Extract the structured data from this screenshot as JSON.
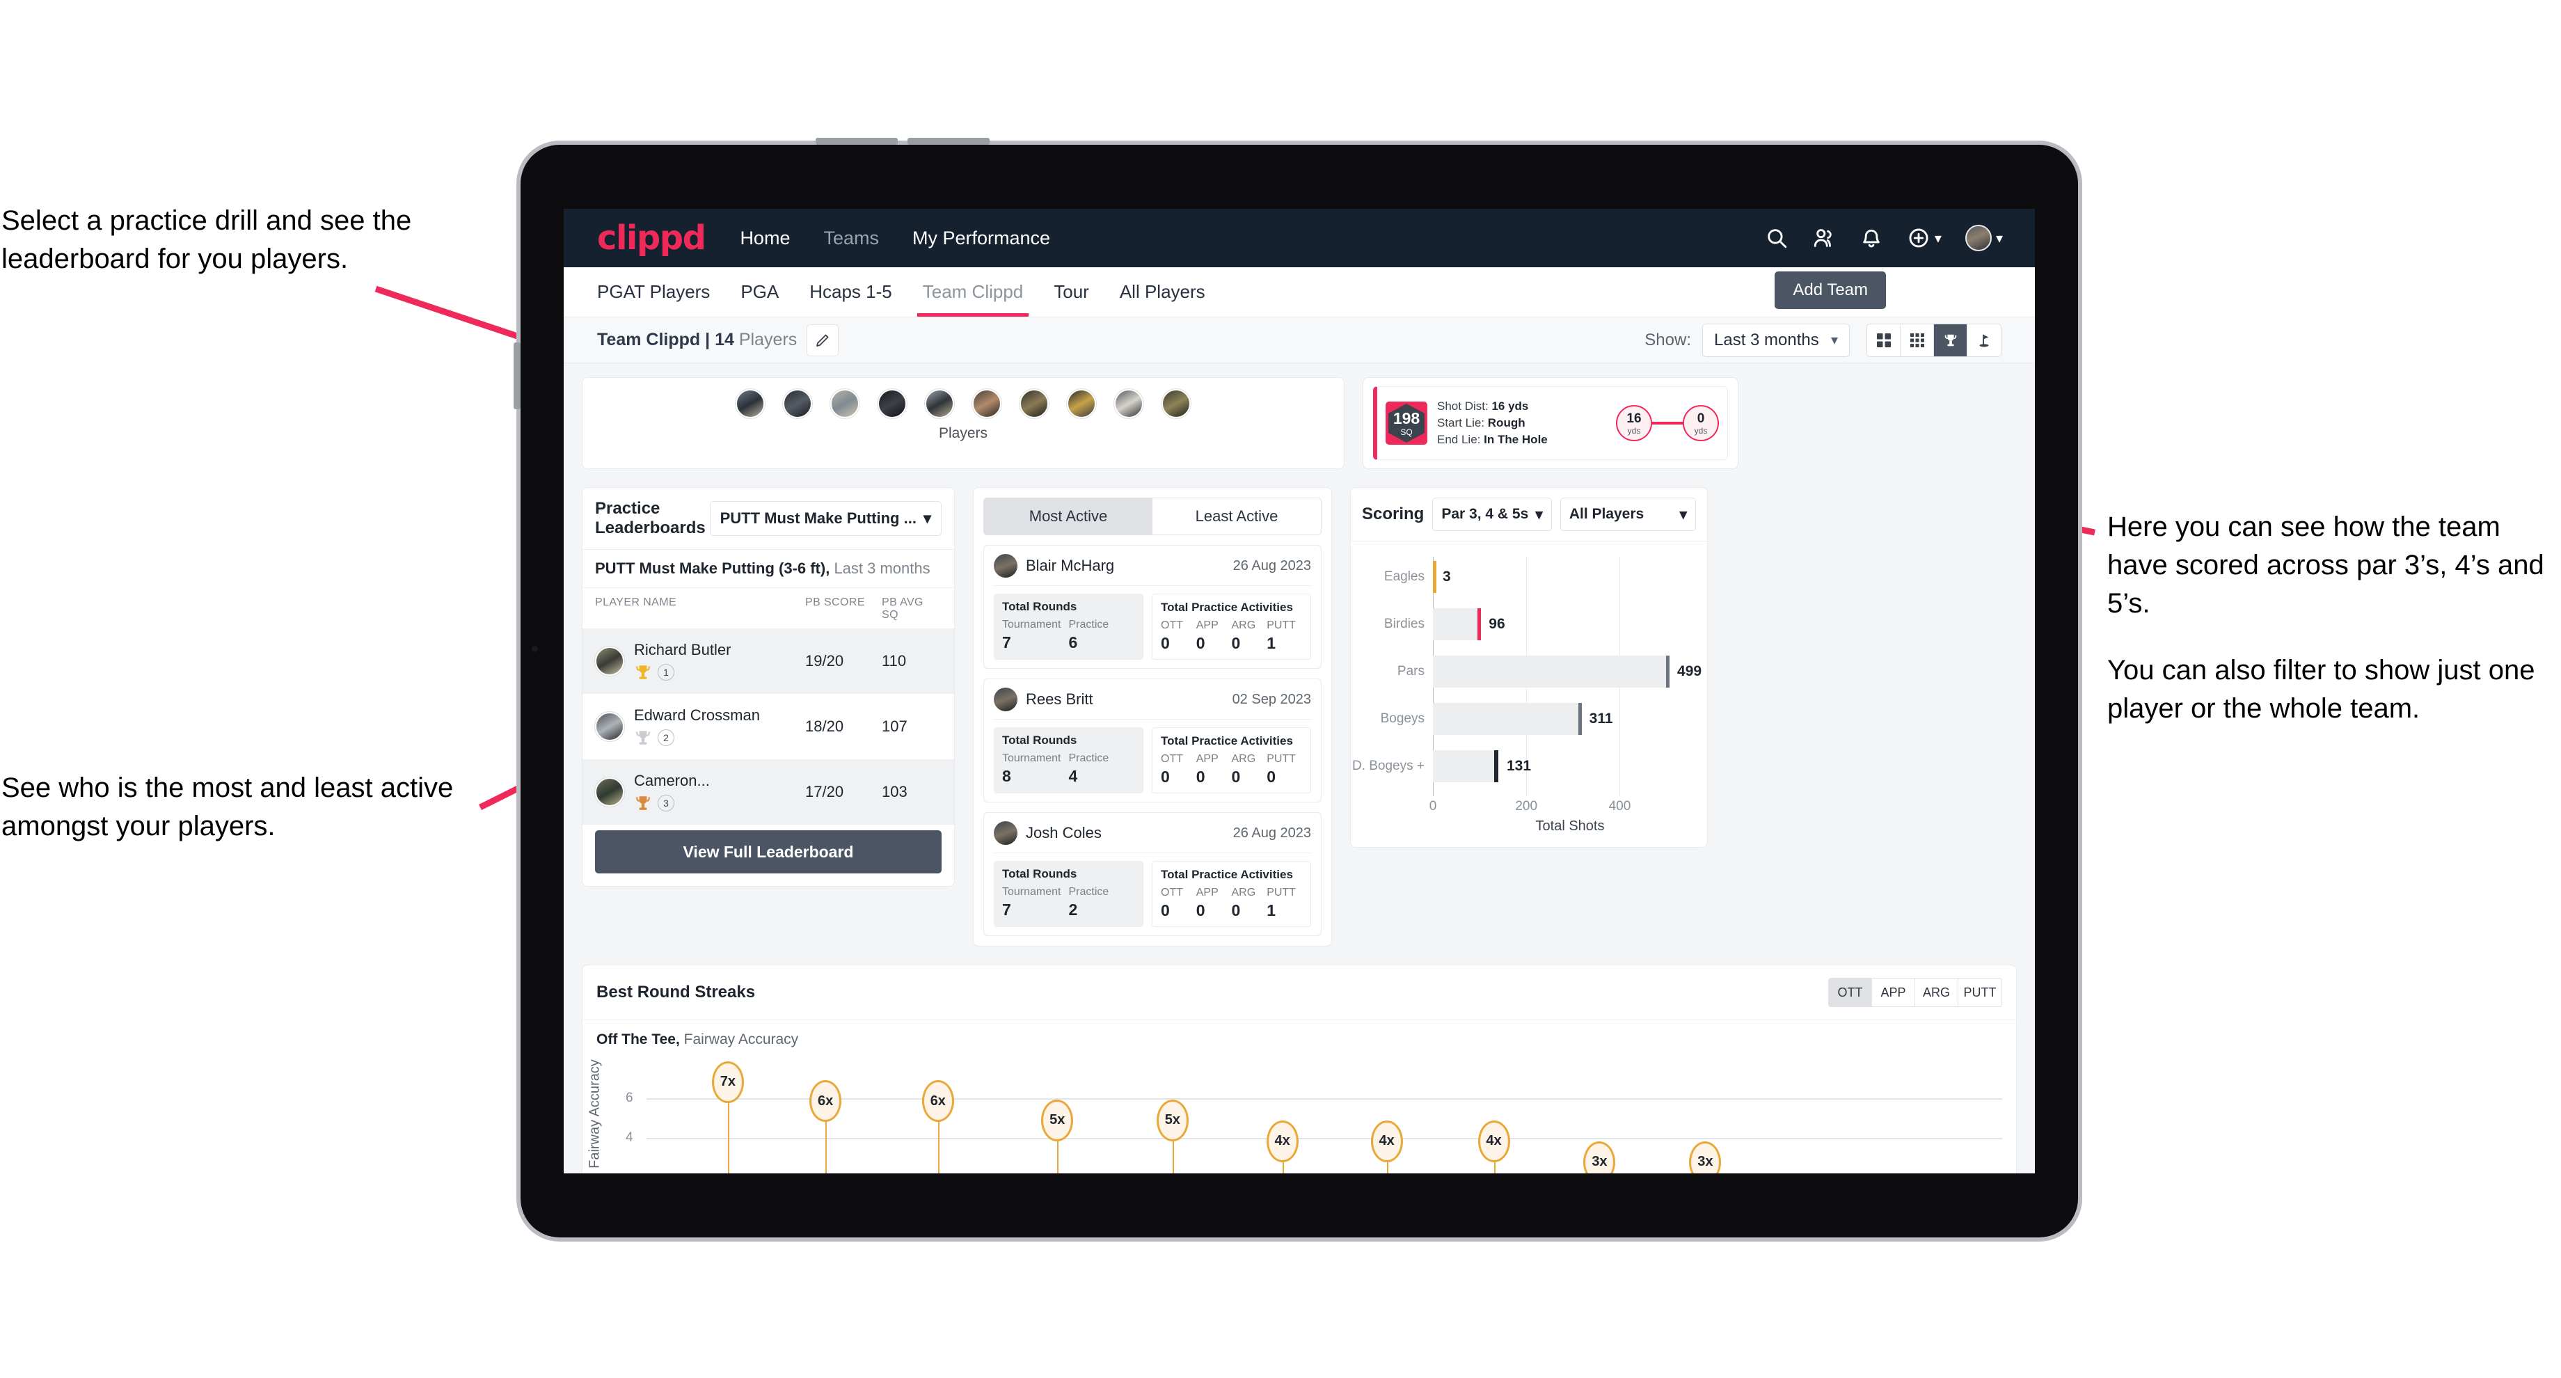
{
  "annotations": {
    "top_left": "Select a practice drill and see the leaderboard for you players.",
    "bottom_left": "See who is the most and least active amongst your players.",
    "right_1": "Here you can see how the team have scored across par 3’s, 4’s and 5’s.",
    "right_2": "You can also filter to show just one player or the whole team."
  },
  "navbar": {
    "logo": "clippd",
    "links": [
      {
        "label": "Home",
        "muted": false
      },
      {
        "label": "Teams",
        "muted": true
      },
      {
        "label": "My Performance",
        "muted": false
      }
    ],
    "icons": [
      "search-icon",
      "people-icon",
      "bell-icon",
      "plus-circle-icon",
      "avatar"
    ]
  },
  "tabs": [
    {
      "label": "PGAT Players",
      "active": false
    },
    {
      "label": "PGA",
      "active": false
    },
    {
      "label": "Hcaps 1-5",
      "active": false
    },
    {
      "label": "Team Clippd",
      "active": true
    },
    {
      "label": "Tour",
      "active": false
    },
    {
      "label": "All Players",
      "active": false
    }
  ],
  "add_team_button": "Add Team",
  "subbar": {
    "team_name": "Team Clippd",
    "separator": "|",
    "player_count": "14",
    "players_word": "Players",
    "edit_icon": "pencil-icon",
    "show_label": "Show:",
    "period_value": "Last 3 months",
    "view_buttons": [
      {
        "icon": "grid-4-icon",
        "selected": false
      },
      {
        "icon": "grid-9-icon",
        "selected": false
      },
      {
        "icon": "trophy-icon",
        "selected": true
      },
      {
        "icon": "golf-flag-icon",
        "selected": false
      }
    ]
  },
  "players_strip": {
    "caption": "Players",
    "count": 10
  },
  "shot_card": {
    "badge_number": "198",
    "badge_unit": "SQ",
    "lines": [
      {
        "label": "Shot Dist:",
        "value": "16 yds"
      },
      {
        "label": "Start Lie:",
        "value": "Rough"
      },
      {
        "label": "End Lie:",
        "value": "In The Hole"
      }
    ],
    "start_value": "16",
    "start_unit": "yds",
    "end_value": "0",
    "end_unit": "yds"
  },
  "leaderboard": {
    "title": "Practice Leaderboards",
    "drill_select": "PUTT Must Make Putting ...",
    "subtitle_bold": "PUTT Must Make Putting (3-6 ft),",
    "subtitle_grey": " Last 3 months",
    "columns": [
      "PLAYER NAME",
      "PB SCORE",
      "PB AVG SQ"
    ],
    "rows": [
      {
        "name": "Richard Butler",
        "rank": "1",
        "medal": "gold",
        "score": "19/20",
        "avg": "110"
      },
      {
        "name": "Edward Crossman",
        "rank": "2",
        "medal": "silver",
        "score": "18/20",
        "avg": "107"
      },
      {
        "name": "Cameron...",
        "rank": "3",
        "medal": "bronze",
        "score": "17/20",
        "avg": "103"
      }
    ],
    "button": "View Full Leaderboard"
  },
  "activity": {
    "tabs": [
      {
        "label": "Most Active",
        "active": true
      },
      {
        "label": "Least Active",
        "active": false
      }
    ],
    "rounds_title": "Total Rounds",
    "rounds_labels": [
      "Tournament",
      "Practice"
    ],
    "acts_title": "Total Practice Activities",
    "acts_labels": [
      "OTT",
      "APP",
      "ARG",
      "PUTT"
    ],
    "players": [
      {
        "name": "Blair McHarg",
        "date": "26 Aug 2023",
        "rounds": [
          "7",
          "6"
        ],
        "acts": [
          "0",
          "0",
          "0",
          "1"
        ]
      },
      {
        "name": "Rees Britt",
        "date": "02 Sep 2023",
        "rounds": [
          "8",
          "4"
        ],
        "acts": [
          "0",
          "0",
          "0",
          "0"
        ]
      },
      {
        "name": "Josh Coles",
        "date": "26 Aug 2023",
        "rounds": [
          "7",
          "2"
        ],
        "acts": [
          "0",
          "0",
          "0",
          "1"
        ]
      }
    ]
  },
  "scoring": {
    "title": "Scoring",
    "par_select": "Par 3, 4 & 5s",
    "players_select": "All Players"
  },
  "streaks": {
    "title": "Best Round Streaks",
    "tabs": [
      {
        "label": "OTT",
        "active": true
      },
      {
        "label": "APP",
        "active": false
      },
      {
        "label": "ARG",
        "active": false
      },
      {
        "label": "PUTT",
        "active": false
      }
    ],
    "subtitle_bold": "Off The Tee,",
    "subtitle_grey": " Fairway Accuracy"
  },
  "chart_data": [
    {
      "type": "bar",
      "orientation": "horizontal",
      "title": "Scoring",
      "categories": [
        "Eagles",
        "Birdies",
        "Pars",
        "Bogeys",
        "D. Bogeys +"
      ],
      "values": [
        3,
        96,
        499,
        311,
        131
      ],
      "bar_cap_colors": [
        "#e8a93a",
        "#ef2a5b",
        "#6b7280",
        "#6b7280",
        "#1e252e"
      ],
      "xlabel": "Total Shots",
      "ylabel": "",
      "xlim": [
        0,
        560
      ],
      "xticks": [
        0,
        200,
        400
      ],
      "grid": true,
      "legend": "none"
    },
    {
      "type": "scatter",
      "title": "Best Round Streaks",
      "subtitle": "Off The Tee, Fairway Accuracy",
      "ylabel": "Streak, Fairway Accuracy",
      "values": [
        7,
        6,
        6,
        5,
        5,
        4,
        4,
        4,
        3,
        3
      ],
      "labels": [
        "7x",
        "6x",
        "6x",
        "5x",
        "5x",
        "4x",
        "4x",
        "4x",
        "3x",
        "3x"
      ],
      "yticks": [
        4,
        6
      ],
      "ylim": [
        0,
        8
      ],
      "grid": true,
      "marker_color": "#e8a93a",
      "legend": "none"
    }
  ]
}
